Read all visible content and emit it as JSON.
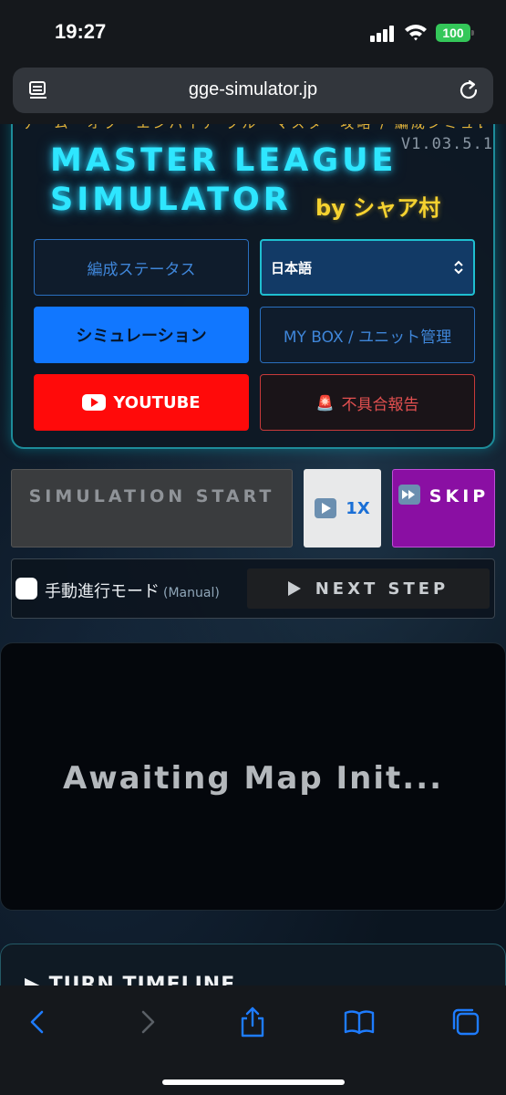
{
  "status_bar": {
    "time": "19:27",
    "battery": "100",
    "battery_color": "#34c759"
  },
  "browser": {
    "url": "gge-simulator.jp",
    "icons": [
      "reader-icon",
      "reload-icon"
    ]
  },
  "header": {
    "marquee": "ゲーム・オブ・エンパイア ブルーマスター攻略 / 編成シミュレーター",
    "version": "V1.03.5.1",
    "title_line1": "MASTER LEAGUE",
    "title_line2": "SIMULATOR",
    "byline": "by シャア村",
    "accent_color": "#2ee6ff"
  },
  "nav": {
    "status_label": "編成ステータス",
    "language_selected": "日本語",
    "simulation_label": "シミュレーション",
    "mybox_label": "MY BOX / ユニット管理",
    "youtube_label": "YOUTUBE",
    "bug_report_icon": "🚨",
    "bug_report_label": "不具合報告"
  },
  "controls": {
    "start_label": "SIMULATION START",
    "speed_label": "1X",
    "skip_label": "SKIP",
    "manual_label": "手動進行モード",
    "manual_sub": "(Manual)",
    "manual_checked": false,
    "next_step_label": "NEXT STEP"
  },
  "map": {
    "placeholder": "Awaiting Map Init..."
  },
  "timeline": {
    "title": "▶ TURN TIMELINE"
  },
  "toolbar": {
    "icons": [
      "back-icon",
      "forward-icon",
      "share-icon",
      "bookmarks-icon",
      "tabs-icon"
    ]
  }
}
